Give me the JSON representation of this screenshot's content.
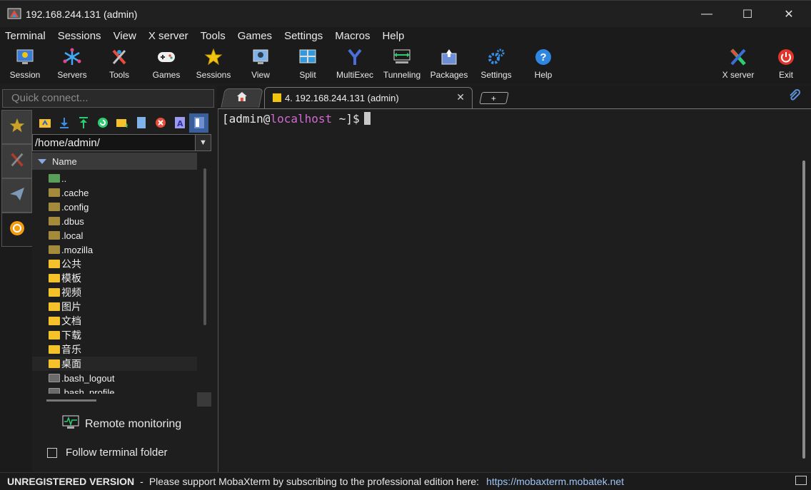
{
  "window": {
    "title": "192.168.244.131 (admin)",
    "min_glyph": "—",
    "max_glyph": "☐",
    "close_glyph": "✕"
  },
  "menu": [
    "Terminal",
    "Sessions",
    "View",
    "X server",
    "Tools",
    "Games",
    "Settings",
    "Macros",
    "Help"
  ],
  "toolbar": {
    "buttons": [
      {
        "label": "Session",
        "icon": "session-icon"
      },
      {
        "label": "Servers",
        "icon": "servers-icon"
      },
      {
        "label": "Tools",
        "icon": "tools-icon"
      },
      {
        "label": "Games",
        "icon": "gamepad-icon"
      },
      {
        "label": "Sessions",
        "icon": "star-icon"
      },
      {
        "label": "View",
        "icon": "view-icon"
      },
      {
        "label": "Split",
        "icon": "split-icon"
      },
      {
        "label": "MultiExec",
        "icon": "multiexec-icon"
      },
      {
        "label": "Tunneling",
        "icon": "tunneling-icon"
      },
      {
        "label": "Packages",
        "icon": "packages-icon"
      },
      {
        "label": "Settings",
        "icon": "settings-gear-icon"
      },
      {
        "label": "Help",
        "icon": "help-icon"
      }
    ],
    "right_buttons": [
      {
        "label": "X server",
        "icon": "x-server-icon"
      },
      {
        "label": "Exit",
        "icon": "power-icon"
      }
    ]
  },
  "quick_connect": {
    "placeholder": "Quick connect..."
  },
  "tabs": {
    "active_label": "4. 192.168.244.131 (admin)",
    "close_glyph": "✕",
    "new_glyph": "+"
  },
  "sftp": {
    "path": "/home/admin/",
    "column_name": "Name",
    "files": [
      {
        "name": "..",
        "type": "up"
      },
      {
        "name": ".cache",
        "type": "folder-dark"
      },
      {
        "name": ".config",
        "type": "folder-dark"
      },
      {
        "name": ".dbus",
        "type": "folder-dark"
      },
      {
        "name": ".local",
        "type": "folder-dark"
      },
      {
        "name": ".mozilla",
        "type": "folder-dark"
      },
      {
        "name": "公共",
        "type": "folder-bright"
      },
      {
        "name": "模板",
        "type": "folder-bright"
      },
      {
        "name": "视频",
        "type": "folder-bright"
      },
      {
        "name": "图片",
        "type": "folder-bright"
      },
      {
        "name": "文档",
        "type": "folder-bright"
      },
      {
        "name": "下载",
        "type": "folder-bright"
      },
      {
        "name": "音乐",
        "type": "folder-bright"
      },
      {
        "name": "桌面",
        "type": "folder-bright"
      },
      {
        "name": ".bash_logout",
        "type": "file"
      },
      {
        "name": ".bash_profile",
        "type": "file"
      }
    ],
    "remote_monitoring": "Remote monitoring",
    "follow_terminal": "Follow terminal folder",
    "follow_checked": false
  },
  "terminal": {
    "prompt_open": "[admin@",
    "prompt_host": "localhost",
    "prompt_close": " ~]$",
    "host_color": "#d26bd2"
  },
  "status": {
    "unregistered": "UNREGISTERED VERSION",
    "separator": "-",
    "message": "Please support MobaXterm by subscribing to the professional edition here:",
    "link": "https://mobaxterm.mobatek.net"
  },
  "colors": {
    "background": "#1e1e1e",
    "accent_link": "#9ec5f5",
    "folder_bright": "#f6c22c"
  }
}
